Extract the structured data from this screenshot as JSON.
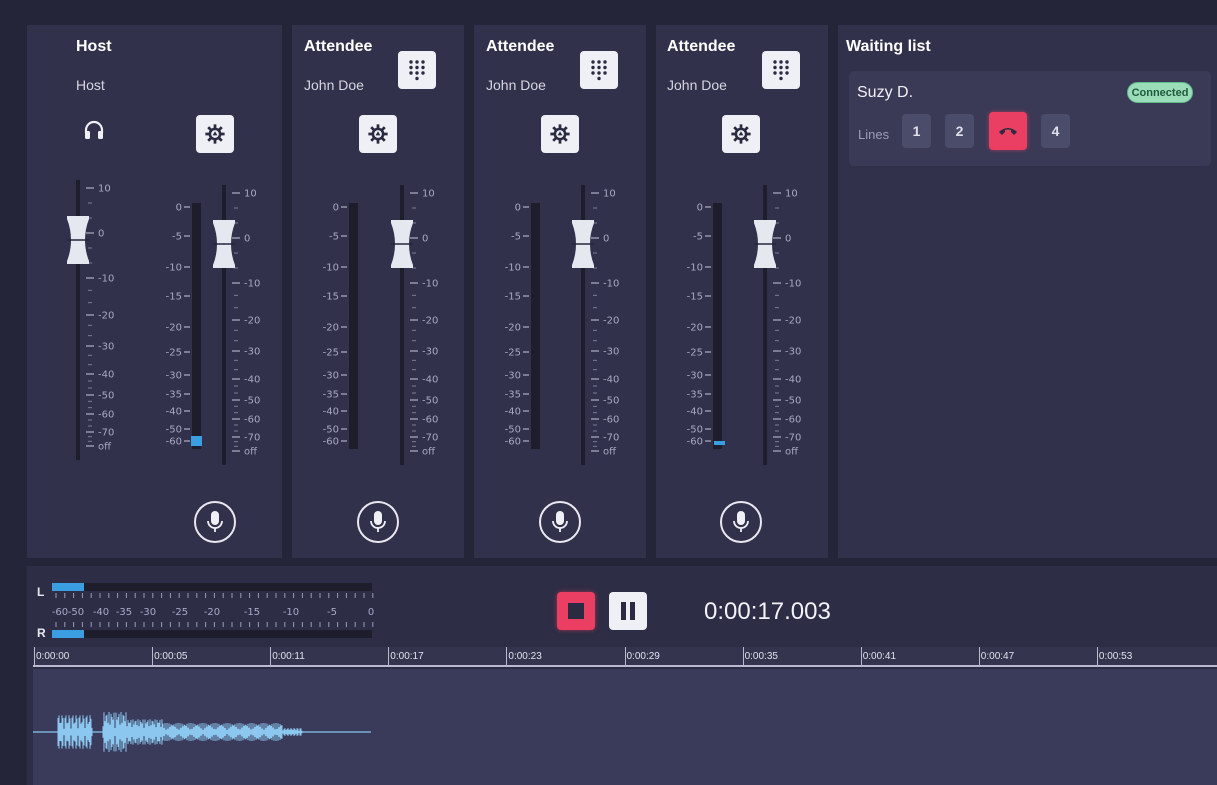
{
  "strips": [
    {
      "title": "Host",
      "subtitle": "Host"
    },
    {
      "title": "Attendee",
      "subtitle": "John Doe"
    },
    {
      "title": "Attendee",
      "subtitle": "John Doe"
    },
    {
      "title": "Attendee",
      "subtitle": "John Doe"
    }
  ],
  "fader_scale": [
    "10",
    "0",
    "-10",
    "-20",
    "-30",
    "-40",
    "-50",
    "-60",
    "-70",
    "off"
  ],
  "meter_scale": [
    "0",
    "-5",
    "-10",
    "-15",
    "-20",
    "-25",
    "-30",
    "-35",
    "-40",
    "-50",
    "-60"
  ],
  "waiting_list": {
    "title": "Waiting list",
    "caller": "Suzy D.",
    "status": "Connected",
    "lines_label": "Lines",
    "lines": [
      "1",
      "2",
      "",
      "4"
    ],
    "hangup_color": "#ea3f63",
    "status_color": "#9bdcb9"
  },
  "master_meter": {
    "left_label": "L",
    "right_label": "R",
    "scale": [
      "-60",
      "-50",
      "-40",
      "-35",
      "-30",
      "-25",
      "-20",
      "-15",
      "-10",
      "-5",
      "0"
    ]
  },
  "transport": {
    "timer": "0:00:17.003",
    "record_color": "#ea3f63"
  },
  "timeline": {
    "labels": [
      "0:00:00",
      "0:00:05",
      "0:00:11",
      "0:00:17",
      "0:00:23",
      "0:00:29",
      "0:00:35",
      "0:00:41",
      "0:00:47",
      "0:00:53"
    ]
  },
  "icons": {
    "headphones": "headphones-icon",
    "gear": "gear-icon",
    "dialpad": "dialpad-icon",
    "mic": "microphone-icon",
    "stop": "stop-icon",
    "pause": "pause-icon",
    "hangup": "phone-hangup-icon"
  },
  "colors": {
    "background": "#25253a",
    "panel": "#31314b",
    "meter_level": "#3a9ee0",
    "waveform": "#8cc7f0"
  }
}
